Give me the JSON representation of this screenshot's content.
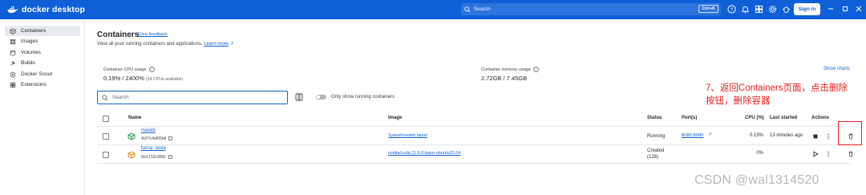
{
  "topbar": {
    "brand": "docker desktop",
    "search_placeholder": "Search",
    "search_shortcut": "Ctrl+K",
    "signin_label": "Sign in"
  },
  "sidebar": {
    "items": [
      {
        "label": "Containers",
        "icon": "container-icon"
      },
      {
        "label": "Images",
        "icon": "images-icon"
      },
      {
        "label": "Volumes",
        "icon": "volumes-icon"
      },
      {
        "label": "Builds",
        "icon": "builds-icon"
      },
      {
        "label": "Docker Scout",
        "icon": "scout-icon"
      },
      {
        "label": "Extensions",
        "icon": "extensions-icon"
      }
    ]
  },
  "main": {
    "title": "Containers",
    "give_feedback": "Give feedback",
    "subtitle": "View all your running containers and applications.",
    "learn_more": "Learn more",
    "cpu_label": "Container CPU usage",
    "cpu_value": "0.19% / 2400%",
    "cpu_sub": "(24 CPUs available)",
    "mem_label": "Container memory usage",
    "mem_value": "2.72GB / 7.45GB",
    "show_charts": "Show charts",
    "search_placeholder": "Search",
    "toggle_label": "Only show running containers"
  },
  "table": {
    "headers": {
      "name": "Name",
      "image": "Image",
      "status": "Status",
      "ports": "Port(s)",
      "cpu": "CPU (%)",
      "started": "Last started",
      "actions": "Actions"
    },
    "rows": [
      {
        "name": "maxkb",
        "id": "4c67c4af05bb",
        "image": "1panel/maxkb:latest",
        "status": "Running",
        "status2": "",
        "ports": "8080:8080",
        "cpu": "0.19%",
        "started": "13 minutes ago"
      },
      {
        "name": "funny_tesla",
        "id": "0cfc153c990c",
        "image": "nvidia/cuda:11.6.0-base-ubuntu22.04",
        "status": "Created",
        "status2": "(128)",
        "ports": "",
        "cpu": "0%",
        "started": ""
      }
    ]
  },
  "annotation": {
    "line1": "7、返回Containers页面，点击删除",
    "line2": "按钮，删除容器"
  },
  "watermark": "CSDN @wal1314520",
  "colors": {
    "accent": "#0f60d8",
    "annotation": "#e0201b"
  }
}
